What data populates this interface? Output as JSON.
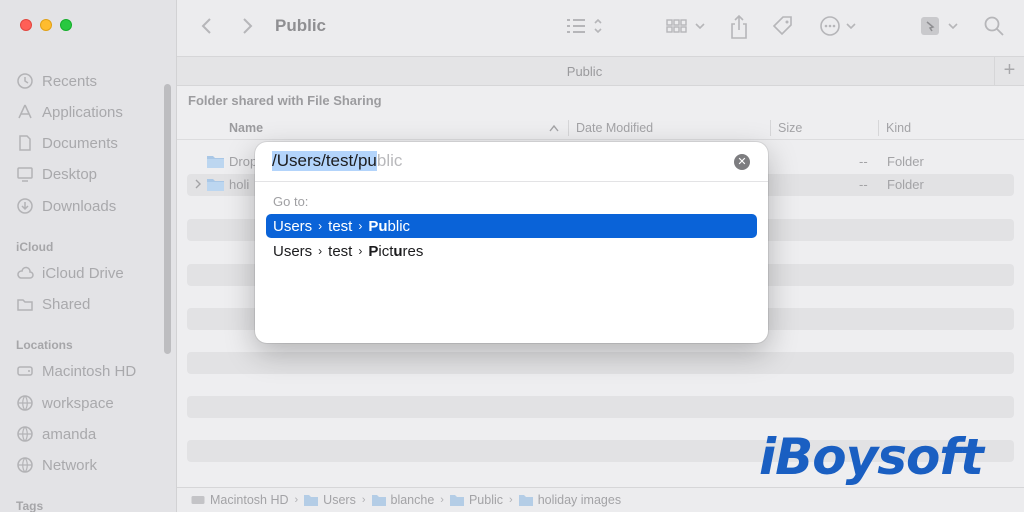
{
  "sidebar": {
    "favorites": [
      {
        "label": "Recents",
        "icon": "clock-icon"
      },
      {
        "label": "Applications",
        "icon": "applications-icon"
      },
      {
        "label": "Documents",
        "icon": "document-icon"
      },
      {
        "label": "Desktop",
        "icon": "desktop-icon"
      },
      {
        "label": "Downloads",
        "icon": "download-icon"
      }
    ],
    "icloud_header": "iCloud",
    "icloud": [
      {
        "label": "iCloud Drive",
        "icon": "cloud-icon"
      },
      {
        "label": "Shared",
        "icon": "shared-folder-icon"
      }
    ],
    "locations_header": "Locations",
    "locations": [
      {
        "label": "Macintosh HD",
        "icon": "disk-icon"
      },
      {
        "label": "workspace",
        "icon": "globe-icon"
      },
      {
        "label": "amanda",
        "icon": "globe-icon"
      },
      {
        "label": "Network",
        "icon": "globe-icon"
      }
    ],
    "tags_header": "Tags"
  },
  "toolbar": {
    "title": "Public"
  },
  "tabbar": {
    "tab_label": "Public",
    "add_label": "+"
  },
  "content": {
    "info_bar": "Folder shared with File Sharing",
    "columns": {
      "name": "Name",
      "date": "Date Modified",
      "size": "Size",
      "kind": "Kind"
    },
    "rows": [
      {
        "name": "Drop",
        "size": "--",
        "kind": "Folder"
      },
      {
        "name": "holi",
        "size": "--",
        "kind": "Folder"
      }
    ]
  },
  "pathbar": [
    "Macintosh HD",
    "Users",
    "blanche",
    "Public",
    "holiday images"
  ],
  "dialog": {
    "typed_selected": "/Users/test/pu",
    "typed_ghost": "blic",
    "clear_label": "✕",
    "goto_label": "Go to:",
    "suggestions": [
      {
        "seg1": "Users",
        "seg2": "test",
        "bold1": "Pu",
        "rest1": "blic",
        "bold2": "",
        "rest2": ""
      },
      {
        "seg1": "Users",
        "seg2": "test",
        "bold1": "P",
        "rest1": "ict",
        "bold2": "u",
        "rest2": "res"
      }
    ],
    "separator": "›"
  },
  "logo": {
    "text": "iBoysoft",
    "color": "#1a5fc2"
  },
  "colors": {
    "accent": "#0a63d8",
    "selection": "#b3d4fb"
  }
}
